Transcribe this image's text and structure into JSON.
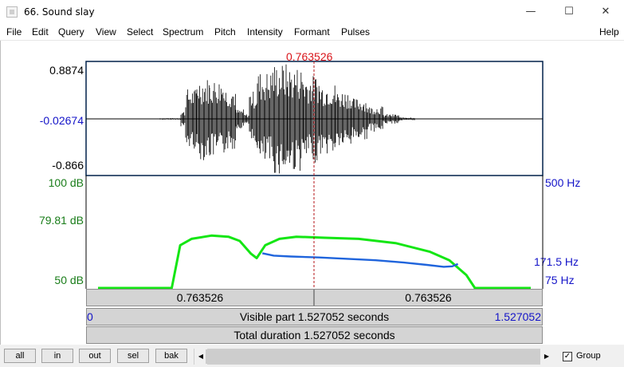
{
  "window": {
    "title": "66. Sound slay",
    "controls": {
      "minimize": "—",
      "maximize": "☐",
      "close": "✕"
    }
  },
  "menu": [
    "File",
    "Edit",
    "Query",
    "View",
    "Select",
    "Spectrum",
    "Pitch",
    "Intensity",
    "Formant",
    "Pulses",
    "Help"
  ],
  "cursor": {
    "time_label": "0.763526",
    "time_seconds": 0.763526
  },
  "waveform": {
    "top_label": "0.8874",
    "mid_label": "-0.02674",
    "bottom_label": "-0.866",
    "ymin": -0.866,
    "ymax": 0.8874
  },
  "analysis": {
    "db_top": "100 dB",
    "db_mid": "79.81 dB",
    "db_bottom": "50 dB",
    "hz_top": "500 Hz",
    "hz_mid": "171.5 Hz",
    "hz_bottom": "75 Hz"
  },
  "timebars": {
    "left_segment": "0.763526",
    "right_segment": "0.763526",
    "visible_start": "0",
    "visible_end": "1.527052",
    "visible_text": "Visible part 1.527052 seconds",
    "total_text": "Total duration 1.527052 seconds"
  },
  "chart_data": {
    "type": "line",
    "x_range": [
      0,
      1.527052
    ],
    "series": [
      {
        "color": "#14e614",
        "y_range_db": [
          50,
          100
        ],
        "x": [
          0.0,
          0.26,
          0.29,
          0.33,
          0.4,
          0.46,
          0.5,
          0.54,
          0.56,
          0.59,
          0.64,
          0.7,
          0.8,
          0.92,
          1.05,
          1.17,
          1.24,
          1.3,
          1.33,
          1.527
        ],
        "y": [
          50,
          50,
          70,
          73,
          74.5,
          74,
          72,
          66,
          64,
          70,
          73,
          74,
          73.5,
          73,
          71,
          67,
          63,
          56,
          50,
          50
        ]
      },
      {
        "color": "#1f64dc",
        "y_range_hz": [
          75,
          500
        ],
        "x": [
          0.58,
          0.62,
          0.68,
          0.78,
          0.88,
          0.98,
          1.08,
          1.16,
          1.22,
          1.25,
          1.27
        ],
        "y": [
          190,
          180,
          176,
          172,
          166,
          160,
          150,
          140,
          132,
          134,
          144
        ]
      }
    ]
  },
  "buttons": {
    "all": "all",
    "in": "in",
    "out": "out",
    "sel": "sel",
    "bak": "bak"
  },
  "scroll": {
    "left": "◀",
    "right": "▶"
  },
  "group": {
    "label": "Group",
    "checked": "✓"
  }
}
